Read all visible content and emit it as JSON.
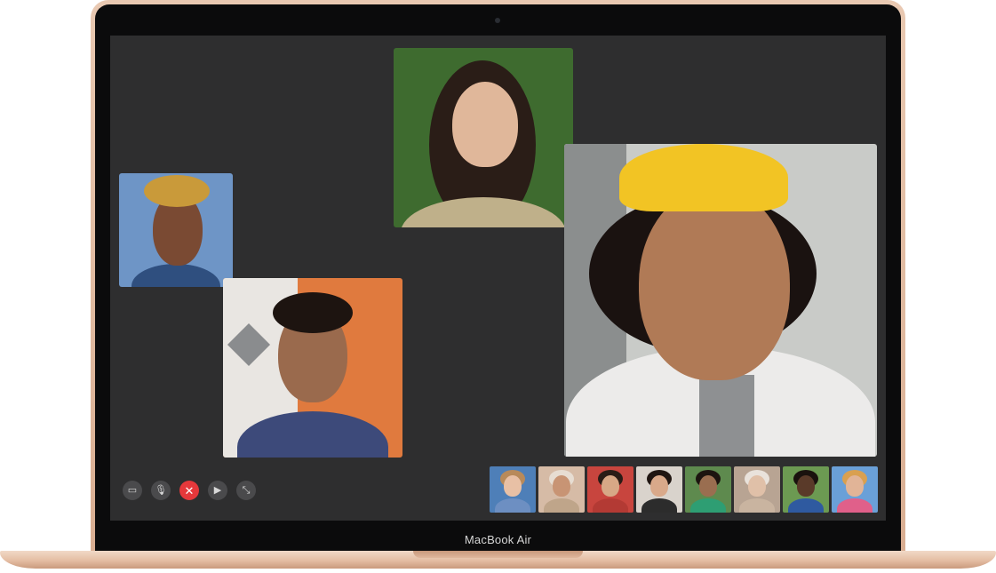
{
  "device": {
    "model_label": "MacBook Air"
  },
  "call": {
    "participants": [
      {
        "id": "woman-top",
        "bg": "#3e6b2f",
        "skin": "#e0b79a",
        "hair": "#2a1d17",
        "shirt": "#bfb08a"
      },
      {
        "id": "woman-left",
        "bg": "#6e95c6",
        "skin": "#7a4a33",
        "hair": "#c99a3a",
        "shirt": "#2f4f7f"
      },
      {
        "id": "man-center",
        "bg": "#e07a3e",
        "skin": "#9a6a4d",
        "hair": "#1d1410",
        "shirt": "#3d4a7a"
      },
      {
        "id": "man-featured",
        "bg": "#c9cbc8",
        "skin": "#b07a56",
        "hair": "#1a1210",
        "shirt": "#ecebea",
        "hat": "#f2c424"
      }
    ],
    "thumbnails": [
      {
        "bg": "#4e7fb8",
        "skin": "#e8c0a5",
        "hair": "#b88a5a",
        "shirt": "#6d8fc2"
      },
      {
        "bg": "#d6bba6",
        "skin": "#c89474",
        "hair": "#e7ddd2",
        "shirt": "#bfa58a"
      },
      {
        "bg": "#c8453e",
        "skin": "#d7a886",
        "hair": "#2a1c16",
        "shirt": "#b33a34"
      },
      {
        "bg": "#d9d3cc",
        "skin": "#d9a98a",
        "hair": "#201612",
        "shirt": "#2c2c2c"
      },
      {
        "bg": "#5e8a4e",
        "skin": "#9a6e50",
        "hair": "#1c140f",
        "shirt": "#2e9e73"
      },
      {
        "bg": "#b8a493",
        "skin": "#e0c0a8",
        "hair": "#e9e2db",
        "shirt": "#c9b4a0"
      },
      {
        "bg": "#6c9a52",
        "skin": "#5a3a29",
        "hair": "#1a120e",
        "shirt": "#2f5aa0"
      },
      {
        "bg": "#6aa0d8",
        "skin": "#e1b497",
        "hair": "#d9a050",
        "shirt": "#e0608a"
      }
    ],
    "controls": [
      {
        "name": "sidebar-button",
        "glyph": "▭",
        "end": false
      },
      {
        "name": "mute-button",
        "glyph": "🎙",
        "end": false
      },
      {
        "name": "end-call-button",
        "glyph": "✕",
        "end": true
      },
      {
        "name": "camera-button",
        "glyph": "▶",
        "end": false
      },
      {
        "name": "fullscreen-button",
        "glyph": "⤡",
        "end": false
      }
    ]
  }
}
